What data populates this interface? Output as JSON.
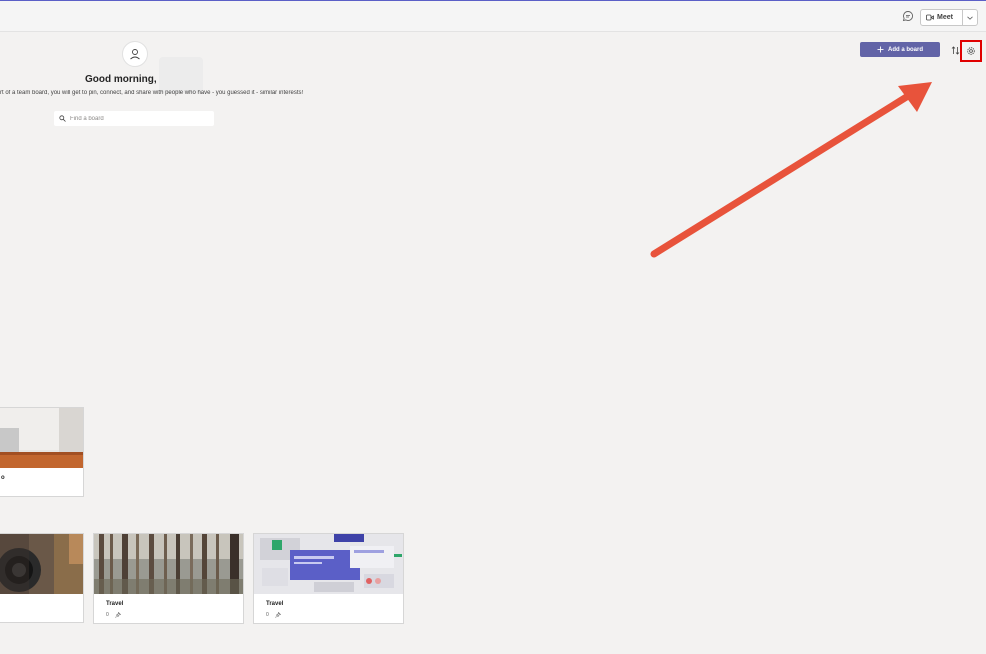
{
  "header": {
    "meet_label": "Meet"
  },
  "welcome": {
    "greeting": "Good morning,",
    "subtitle": "rt of a team board, you will get to pin, connect, and share with people who have - you guessed it - similar interests!"
  },
  "search": {
    "placeholder": "Find a board",
    "value": ""
  },
  "toolbar": {
    "add_board_label": "Add a board"
  },
  "boards": [
    {
      "title": "o",
      "count": ""
    },
    {
      "title": "",
      "count": ""
    },
    {
      "title": "Travel",
      "count": "0"
    },
    {
      "title": "Travel",
      "count": "0"
    }
  ],
  "colors": {
    "accent": "#6264a7",
    "highlight": "#e00000",
    "arrow": "#e8533b",
    "background": "#f3f2f1"
  },
  "icons": [
    "chat-icon",
    "meet-camera-icon",
    "chevron-down-icon",
    "person-icon",
    "search-icon",
    "plus-icon",
    "sort-icon",
    "gear-icon",
    "pin-icon"
  ]
}
